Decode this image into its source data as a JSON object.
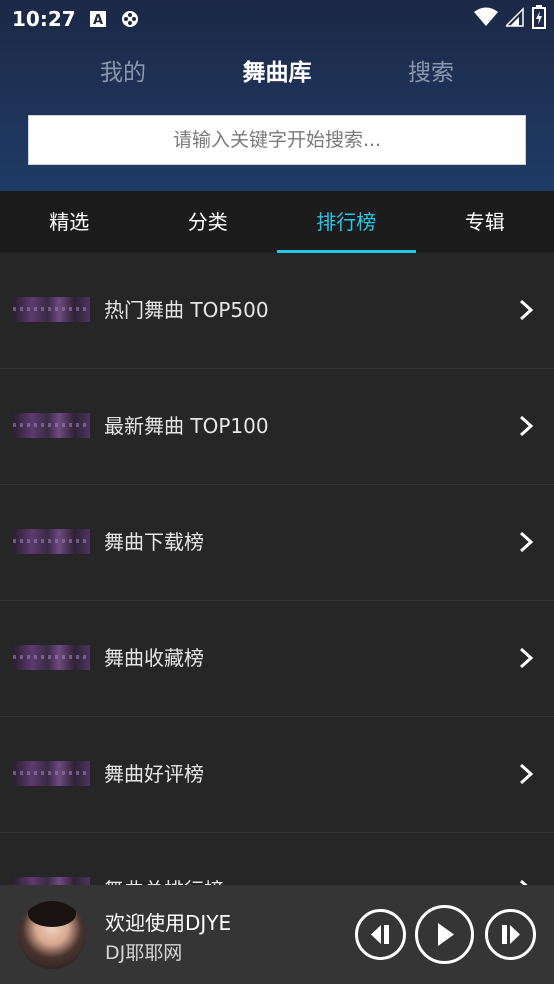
{
  "status_bar": {
    "time": "10:27",
    "icons": [
      "font-a-icon",
      "game-pad-icon",
      "wifi-icon",
      "signal-icon",
      "battery-charging-icon"
    ]
  },
  "top_tabs": [
    {
      "label": "我的",
      "active": false
    },
    {
      "label": "舞曲库",
      "active": true
    },
    {
      "label": "搜索",
      "active": false
    }
  ],
  "search": {
    "placeholder": "请输入关键字开始搜索..."
  },
  "sub_tabs": [
    {
      "label": "精选",
      "active": false
    },
    {
      "label": "分类",
      "active": false
    },
    {
      "label": "排行榜",
      "active": true
    },
    {
      "label": "专辑",
      "active": false
    }
  ],
  "rank_list": [
    {
      "label": "热门舞曲 TOP500"
    },
    {
      "label": "最新舞曲 TOP100"
    },
    {
      "label": "舞曲下载榜"
    },
    {
      "label": "舞曲收藏榜"
    },
    {
      "label": "舞曲好评榜"
    },
    {
      "label": "舞曲总排行榜"
    }
  ],
  "player": {
    "title": "欢迎使用DJYE",
    "subtitle": "DJ耶耶网"
  },
  "colors": {
    "accent": "#29c6e6",
    "header_top": "#1c2846",
    "header_bottom": "#1e3b66",
    "list_bg": "#262626",
    "player_bg": "#353535"
  }
}
